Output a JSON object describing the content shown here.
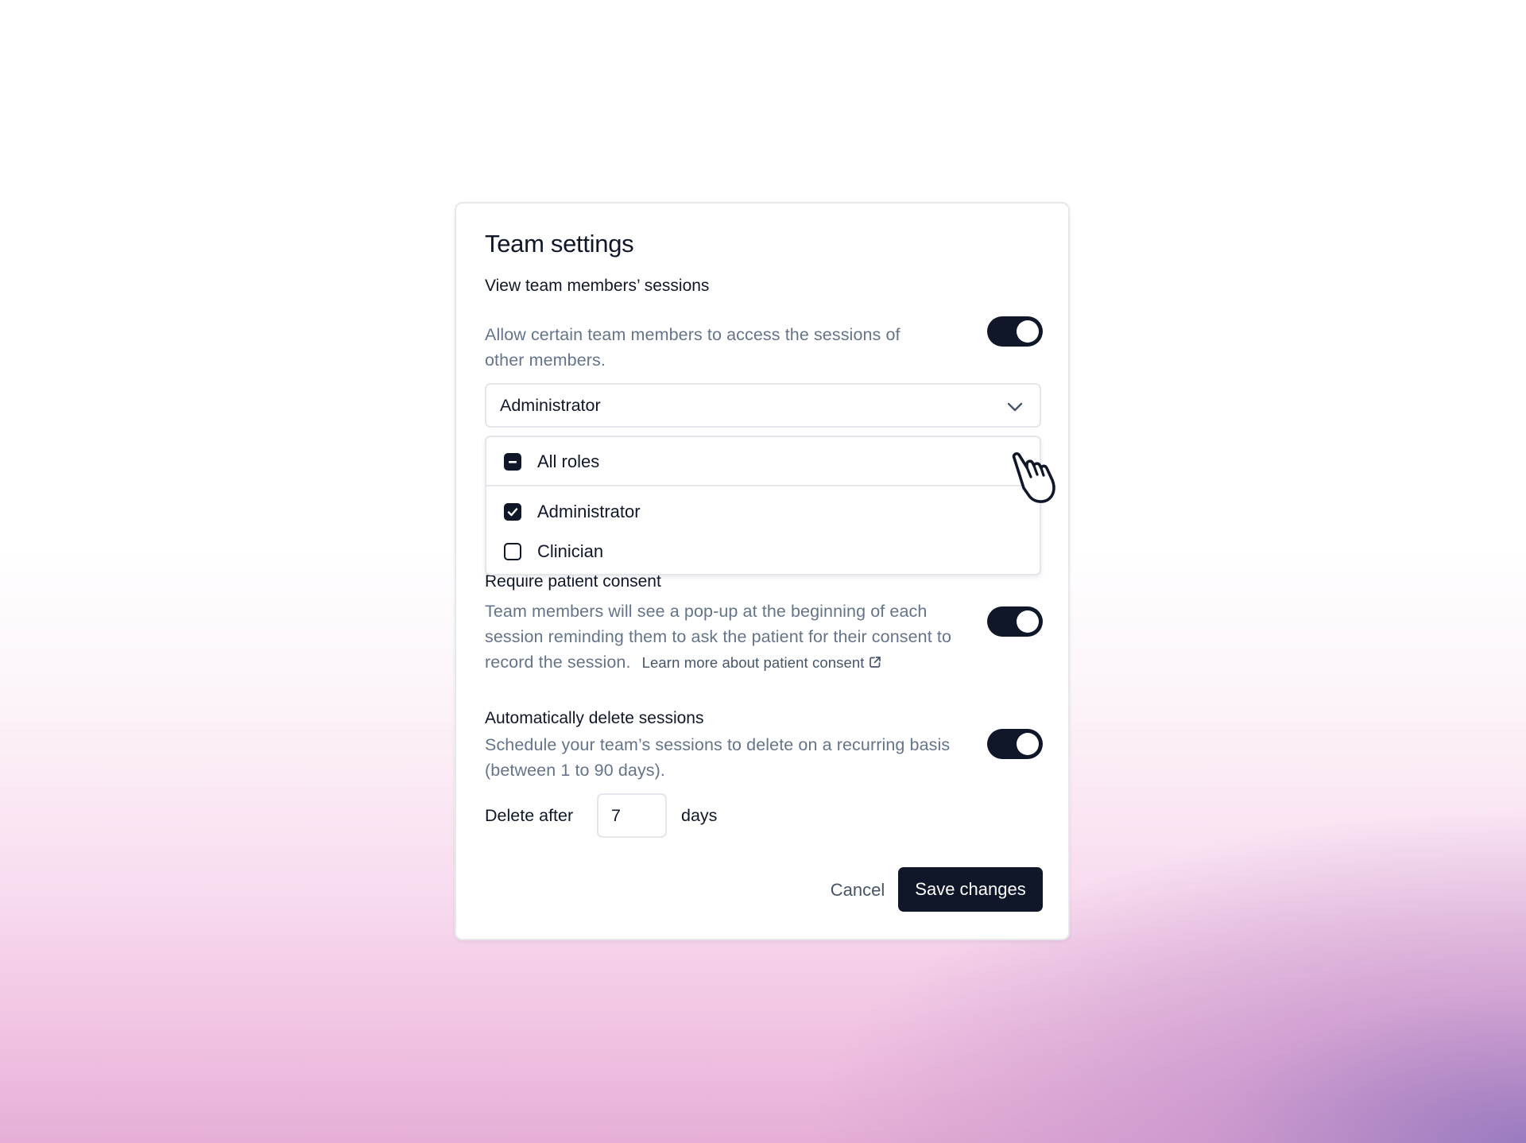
{
  "dialog": {
    "title": "Team settings"
  },
  "sections": {
    "view_sessions": {
      "title": "View team members’ sessions",
      "description": "Allow certain team members to access the sessions of other members.",
      "enabled": true
    },
    "patient_consent": {
      "title": "Require patient consent",
      "description": "Team members will see a pop-up at the beginning of each session reminding them to ask the patient for their consent to record the session.",
      "link_label": "Learn more about patient consent",
      "link_icon": "external-link-icon",
      "enabled": true
    },
    "auto_delete": {
      "title": "Automatically delete sessions",
      "description": "Schedule your team’s sessions to delete on a recurring basis (between 1 to 90 days).",
      "enabled": true,
      "delete_after_label": "Delete after",
      "days_value": "7",
      "days_unit": "days"
    }
  },
  "role_select": {
    "selected_value": "Administrator",
    "chevron_icon": "chevron-down-icon",
    "options": [
      {
        "label": "All roles",
        "state": "indeterminate"
      },
      {
        "label": "Administrator",
        "state": "checked"
      },
      {
        "label": "Clinician",
        "state": "unchecked"
      }
    ]
  },
  "footer": {
    "cancel_label": "Cancel",
    "save_label": "Save changes"
  },
  "colors": {
    "primary": "#0f1729",
    "muted_text": "#64748b",
    "border": "#e3e6ea"
  }
}
